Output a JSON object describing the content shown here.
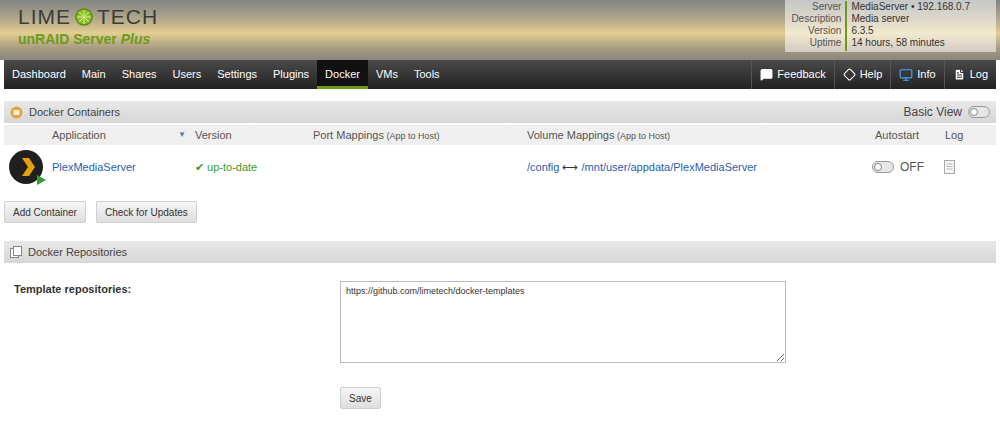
{
  "header": {
    "logo": {
      "brand_left": "LIME",
      "brand_right": "TECH",
      "product": "unRAID Server",
      "edition": "Plus"
    },
    "server_info": [
      {
        "label": "Server",
        "value": "MediaServer • 192.168.0.7"
      },
      {
        "label": "Description",
        "value": "Media server"
      },
      {
        "label": "Version",
        "value": "6.3.5"
      },
      {
        "label": "Uptime",
        "value": "14 hours, 58 minutes"
      }
    ]
  },
  "nav": {
    "tabs": [
      {
        "label": "Dashboard",
        "selected": false
      },
      {
        "label": "Main",
        "selected": false
      },
      {
        "label": "Shares",
        "selected": false
      },
      {
        "label": "Users",
        "selected": false
      },
      {
        "label": "Settings",
        "selected": false
      },
      {
        "label": "Plugins",
        "selected": false
      },
      {
        "label": "Docker",
        "selected": true
      },
      {
        "label": "VMs",
        "selected": false
      },
      {
        "label": "Tools",
        "selected": false
      }
    ],
    "right": [
      {
        "label": "Feedback",
        "icon": "feedback"
      },
      {
        "label": "Help",
        "icon": "help"
      },
      {
        "label": "Info",
        "icon": "info"
      },
      {
        "label": "Log",
        "icon": "log"
      }
    ]
  },
  "containers": {
    "title": "Docker Containers",
    "basic_view": {
      "label": "Basic View",
      "on": false
    },
    "columns": [
      {
        "label": "Application",
        "note": "",
        "sort": "▼"
      },
      {
        "label": "Version",
        "note": "",
        "sort": ""
      },
      {
        "label": "Port Mappings",
        "note": "(App to Host)",
        "sort": ""
      },
      {
        "label": "Volume Mappings",
        "note": "(App to Host)",
        "sort": ""
      },
      {
        "label": "Autostart",
        "note": "",
        "sort": ""
      },
      {
        "label": "Log",
        "note": "",
        "sort": ""
      }
    ],
    "rows": [
      {
        "name": "PlexMediaServer",
        "started": true,
        "version_mark": "✔",
        "version": "up-to-date",
        "port_mappings": "",
        "volume": {
          "app": "/config",
          "arrow": "⟷",
          "host": "/mnt/user/appdata/PlexMediaServer"
        },
        "autostart": {
          "on": false,
          "label": "OFF"
        }
      }
    ]
  },
  "buttons": [
    "Add Container",
    "Check for Updates"
  ],
  "repositories": {
    "title": "Docker Repositories",
    "label": "Template repositories:",
    "value": "https://github.com/limetech/docker-templates",
    "save": "Save"
  }
}
